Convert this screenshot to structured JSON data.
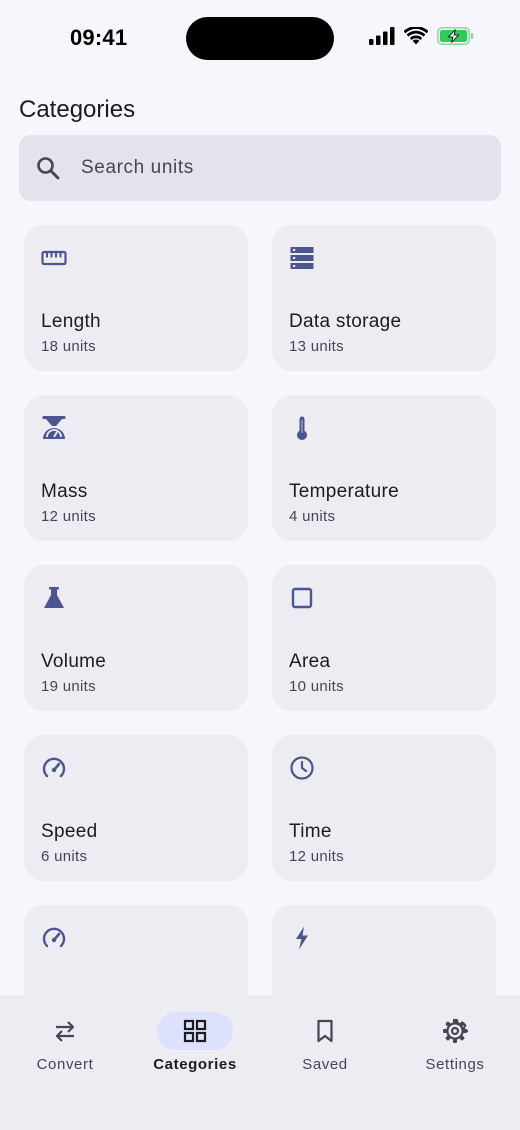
{
  "status_bar": {
    "time": "09:41"
  },
  "page": {
    "title": "Categories"
  },
  "search": {
    "placeholder": "Search units"
  },
  "categories": [
    {
      "name": "Length",
      "count": "18 units",
      "icon": "ruler-icon"
    },
    {
      "name": "Data storage",
      "count": "13 units",
      "icon": "storage-icon"
    },
    {
      "name": "Mass",
      "count": "12 units",
      "icon": "scale-icon"
    },
    {
      "name": "Temperature",
      "count": "4 units",
      "icon": "thermometer-icon"
    },
    {
      "name": "Volume",
      "count": "19 units",
      "icon": "flask-icon"
    },
    {
      "name": "Area",
      "count": "10 units",
      "icon": "square-icon"
    },
    {
      "name": "Speed",
      "count": "6 units",
      "icon": "speedometer-icon"
    },
    {
      "name": "Time",
      "count": "12 units",
      "icon": "clock-icon"
    },
    {
      "name": "",
      "count": "",
      "icon": "speedometer-icon"
    },
    {
      "name": "",
      "count": "",
      "icon": "bolt-icon"
    }
  ],
  "nav": {
    "items": [
      {
        "label": "Convert",
        "icon": "swap-arrows-icon",
        "active": false
      },
      {
        "label": "Categories",
        "icon": "grid-icon",
        "active": true
      },
      {
        "label": "Saved",
        "icon": "bookmark-icon",
        "active": false
      },
      {
        "label": "Settings",
        "icon": "gear-icon",
        "active": false
      }
    ]
  },
  "colors": {
    "background": "#f7f6fc",
    "card": "#edecf3",
    "accent_icon": "#4b5590",
    "nav_active_pill": "#dde1fb",
    "battery_green": "#34c759"
  }
}
